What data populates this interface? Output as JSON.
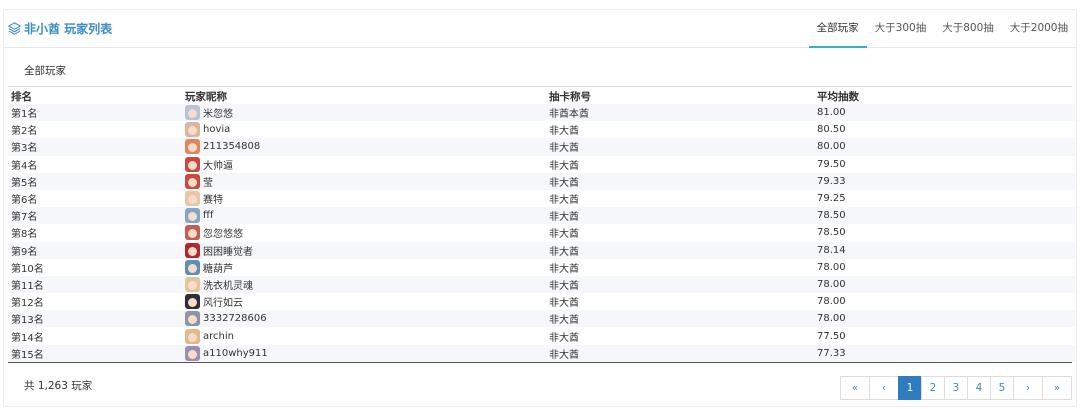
{
  "header": {
    "title": "非小酋 玩家列表",
    "tabs": [
      "全部玩家",
      "大于300抽",
      "大于800抽",
      "大于2000抽"
    ],
    "active_tab": 0
  },
  "subtab": {
    "label": "全部玩家"
  },
  "table": {
    "columns": [
      "排名",
      "玩家昵称",
      "抽卡称号",
      "平均抽数"
    ],
    "rows": [
      {
        "rank": "第1名",
        "name": "米忽悠",
        "title": "非酋本酋",
        "avg": "81.00",
        "avatar": "#b9c3d6"
      },
      {
        "rank": "第2名",
        "name": "hovia",
        "title": "非大酋",
        "avg": "80.50",
        "avatar": "#d9b7a5"
      },
      {
        "rank": "第3名",
        "name": "211354808",
        "title": "非大酋",
        "avg": "80.00",
        "avatar": "#e0875b"
      },
      {
        "rank": "第4名",
        "name": "大帅逼",
        "title": "非大酋",
        "avg": "79.50",
        "avatar": "#c9493f"
      },
      {
        "rank": "第5名",
        "name": "莹",
        "title": "非大酋",
        "avg": "79.33",
        "avatar": "#c94c3a"
      },
      {
        "rank": "第6名",
        "name": "赛特",
        "title": "非大酋",
        "avg": "79.25",
        "avatar": "#e7c9a0"
      },
      {
        "rank": "第7名",
        "name": "fff",
        "title": "非大酋",
        "avg": "78.50",
        "avatar": "#7fa7c9"
      },
      {
        "rank": "第8名",
        "name": "忽忽悠悠",
        "title": "非大酋",
        "avg": "78.50",
        "avatar": "#c95b4a"
      },
      {
        "rank": "第9名",
        "name": "困困睡觉者",
        "title": "非大酋",
        "avg": "78.14",
        "avatar": "#b2282b"
      },
      {
        "rank": "第10名",
        "name": "糖葫芦",
        "title": "非大酋",
        "avg": "78.00",
        "avatar": "#5f8fb8"
      },
      {
        "rank": "第11名",
        "name": "洗衣机灵魂",
        "title": "非大酋",
        "avg": "78.00",
        "avatar": "#e2c79a"
      },
      {
        "rank": "第12名",
        "name": "风行如云",
        "title": "非大酋",
        "avg": "78.00",
        "avatar": "#2f2f3a"
      },
      {
        "rank": "第13名",
        "name": "3332728606",
        "title": "非大酋",
        "avg": "78.00",
        "avatar": "#8a96a8"
      },
      {
        "rank": "第14名",
        "name": "archin",
        "title": "非大酋",
        "avg": "77.50",
        "avatar": "#e3b98c"
      },
      {
        "rank": "第15名",
        "name": "a110why911",
        "title": "非大酋",
        "avg": "77.33",
        "avatar": "#9b8fb0"
      }
    ]
  },
  "footer": {
    "total": "共 1,263 玩家",
    "pager": [
      "«",
      "‹",
      "1",
      "2",
      "3",
      "4",
      "5",
      "›",
      "»"
    ],
    "active_page": "1"
  },
  "colors": {
    "accent": "#3a8ec9",
    "tab_underline": "#3aafc1",
    "page_active": "#2f7bc0"
  },
  "icons": {
    "title": "layers-icon"
  }
}
